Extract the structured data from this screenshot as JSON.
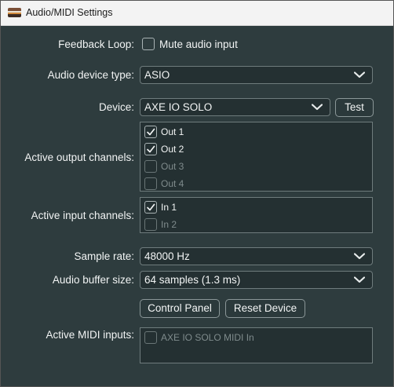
{
  "window": {
    "title": "Audio/MIDI Settings"
  },
  "feedback": {
    "label": "Feedback Loop:",
    "checkbox_label": "Mute audio input"
  },
  "device_type": {
    "label": "Audio device type:",
    "value": "ASIO"
  },
  "device": {
    "label": "Device:",
    "value": "AXE IO SOLO",
    "test_label": "Test"
  },
  "output_channels": {
    "label": "Active output channels:",
    "items": [
      {
        "label": "Out 1",
        "checked": true
      },
      {
        "label": "Out 2",
        "checked": true
      },
      {
        "label": "Out 3",
        "checked": false
      },
      {
        "label": "Out 4",
        "checked": false
      }
    ]
  },
  "input_channels": {
    "label": "Active input channels:",
    "items": [
      {
        "label": "In 1",
        "checked": true
      },
      {
        "label": "In 2",
        "checked": false
      }
    ]
  },
  "sample_rate": {
    "label": "Sample rate:",
    "value": "48000 Hz"
  },
  "buffer_size": {
    "label": "Audio buffer size:",
    "value": "64 samples (1.3 ms)"
  },
  "buttons": {
    "control_panel": "Control Panel",
    "reset_device": "Reset Device"
  },
  "midi_inputs": {
    "label": "Active MIDI inputs:",
    "items": [
      {
        "label": "AXE IO SOLO MIDI In",
        "checked": false
      }
    ]
  }
}
